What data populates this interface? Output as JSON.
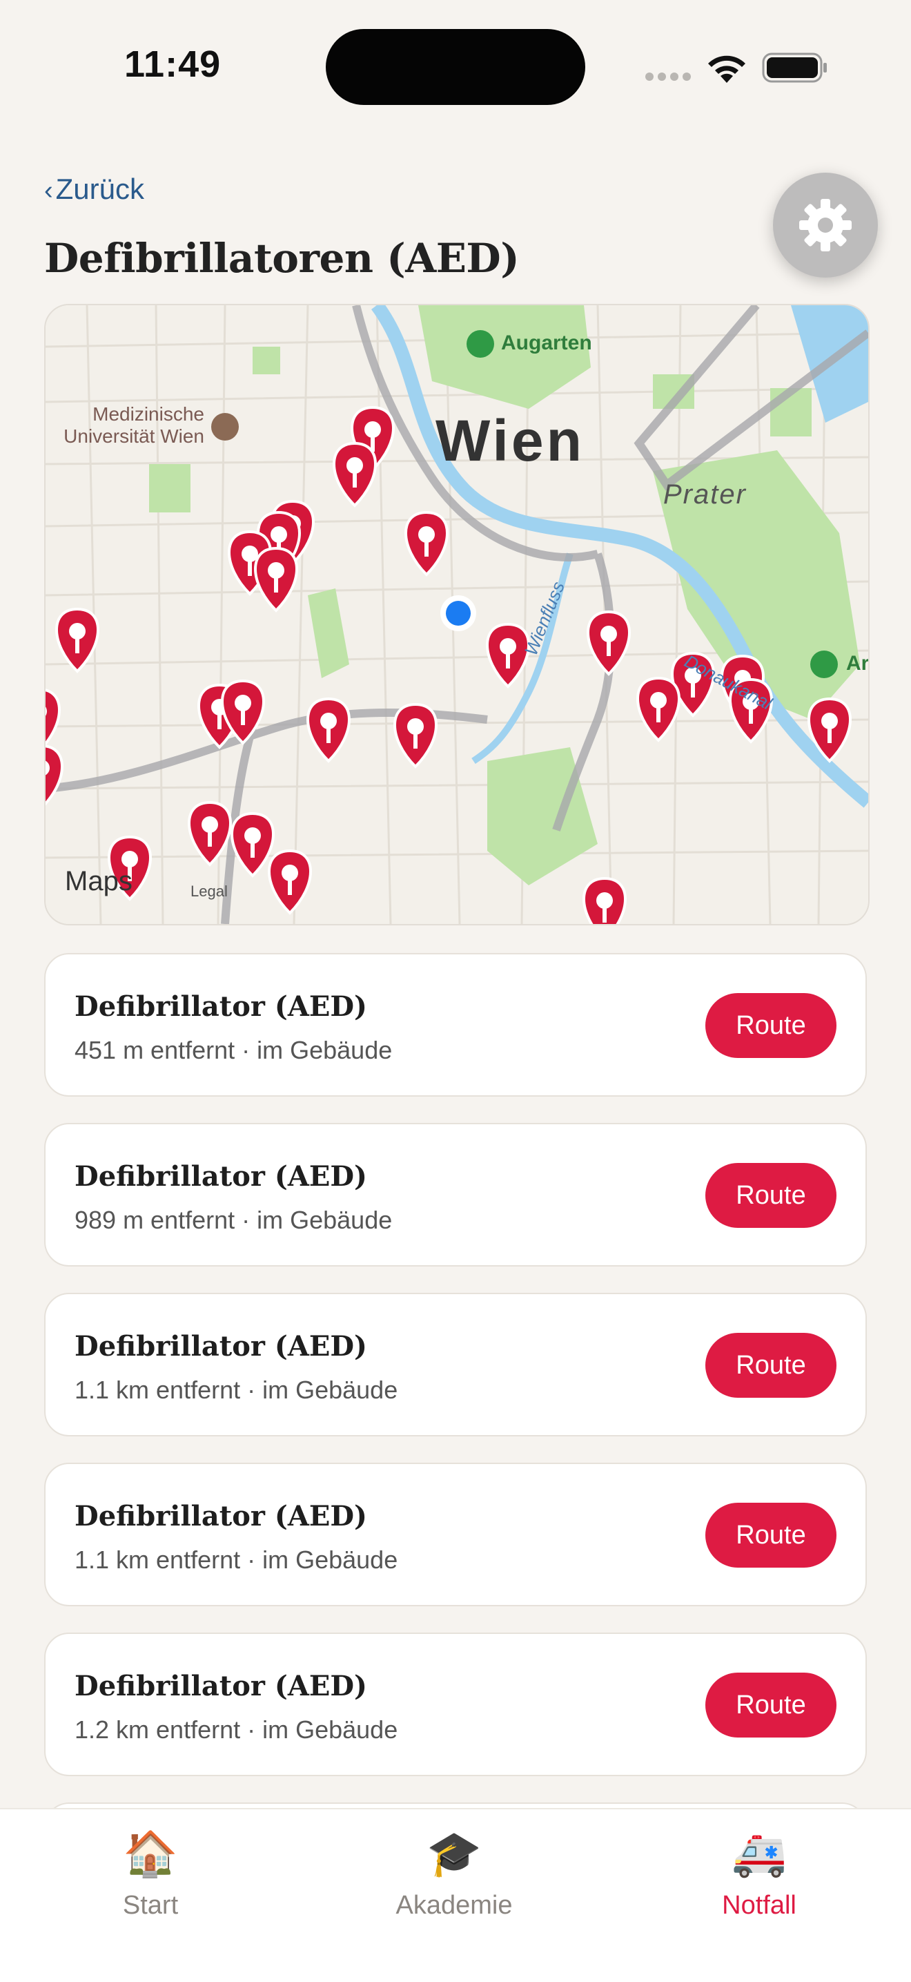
{
  "status_bar": {
    "time": "11:49"
  },
  "header": {
    "back_label": "Zurück",
    "title": "Defibrillatoren (AED)",
    "settings_icon": "gear-icon"
  },
  "map": {
    "labels": {
      "city": "Wien",
      "prater": "Prater",
      "augarten": "Augarten",
      "uni": "Medizinische Universität Wien",
      "ar": "Ar",
      "wienfluss": "Wienfluss",
      "donaukanal": "Donaukanal",
      "maps": "Maps",
      "legal": "Legal"
    },
    "colors": {
      "pin": "#d4173a",
      "user": "#1b7cf2",
      "water": "#9fd2f0",
      "park": "#bfe3a8"
    }
  },
  "list": {
    "items": [
      {
        "title": "Defibrillator (AED)",
        "subtitle": "451 m entfernt · im Gebäude",
        "action": "Route"
      },
      {
        "title": "Defibrillator (AED)",
        "subtitle": "989 m entfernt · im Gebäude",
        "action": "Route"
      },
      {
        "title": "Defibrillator (AED)",
        "subtitle": "1.1 km entfernt · im Gebäude",
        "action": "Route"
      },
      {
        "title": "Defibrillator (AED)",
        "subtitle": "1.1 km entfernt · im Gebäude",
        "action": "Route"
      },
      {
        "title": "Defibrillator (AED)",
        "subtitle": "1.2 km entfernt · im Gebäude",
        "action": "Route"
      }
    ]
  },
  "tab_bar": {
    "tabs": [
      {
        "label": "Start",
        "icon": "🏠",
        "active": false
      },
      {
        "label": "Akademie",
        "icon": "🎓",
        "active": false
      },
      {
        "label": "Notfall",
        "icon": "🚑",
        "active": true
      }
    ]
  },
  "colors": {
    "accent": "#de1b43",
    "link": "#2a5a8c",
    "background": "#f6f3ef"
  }
}
